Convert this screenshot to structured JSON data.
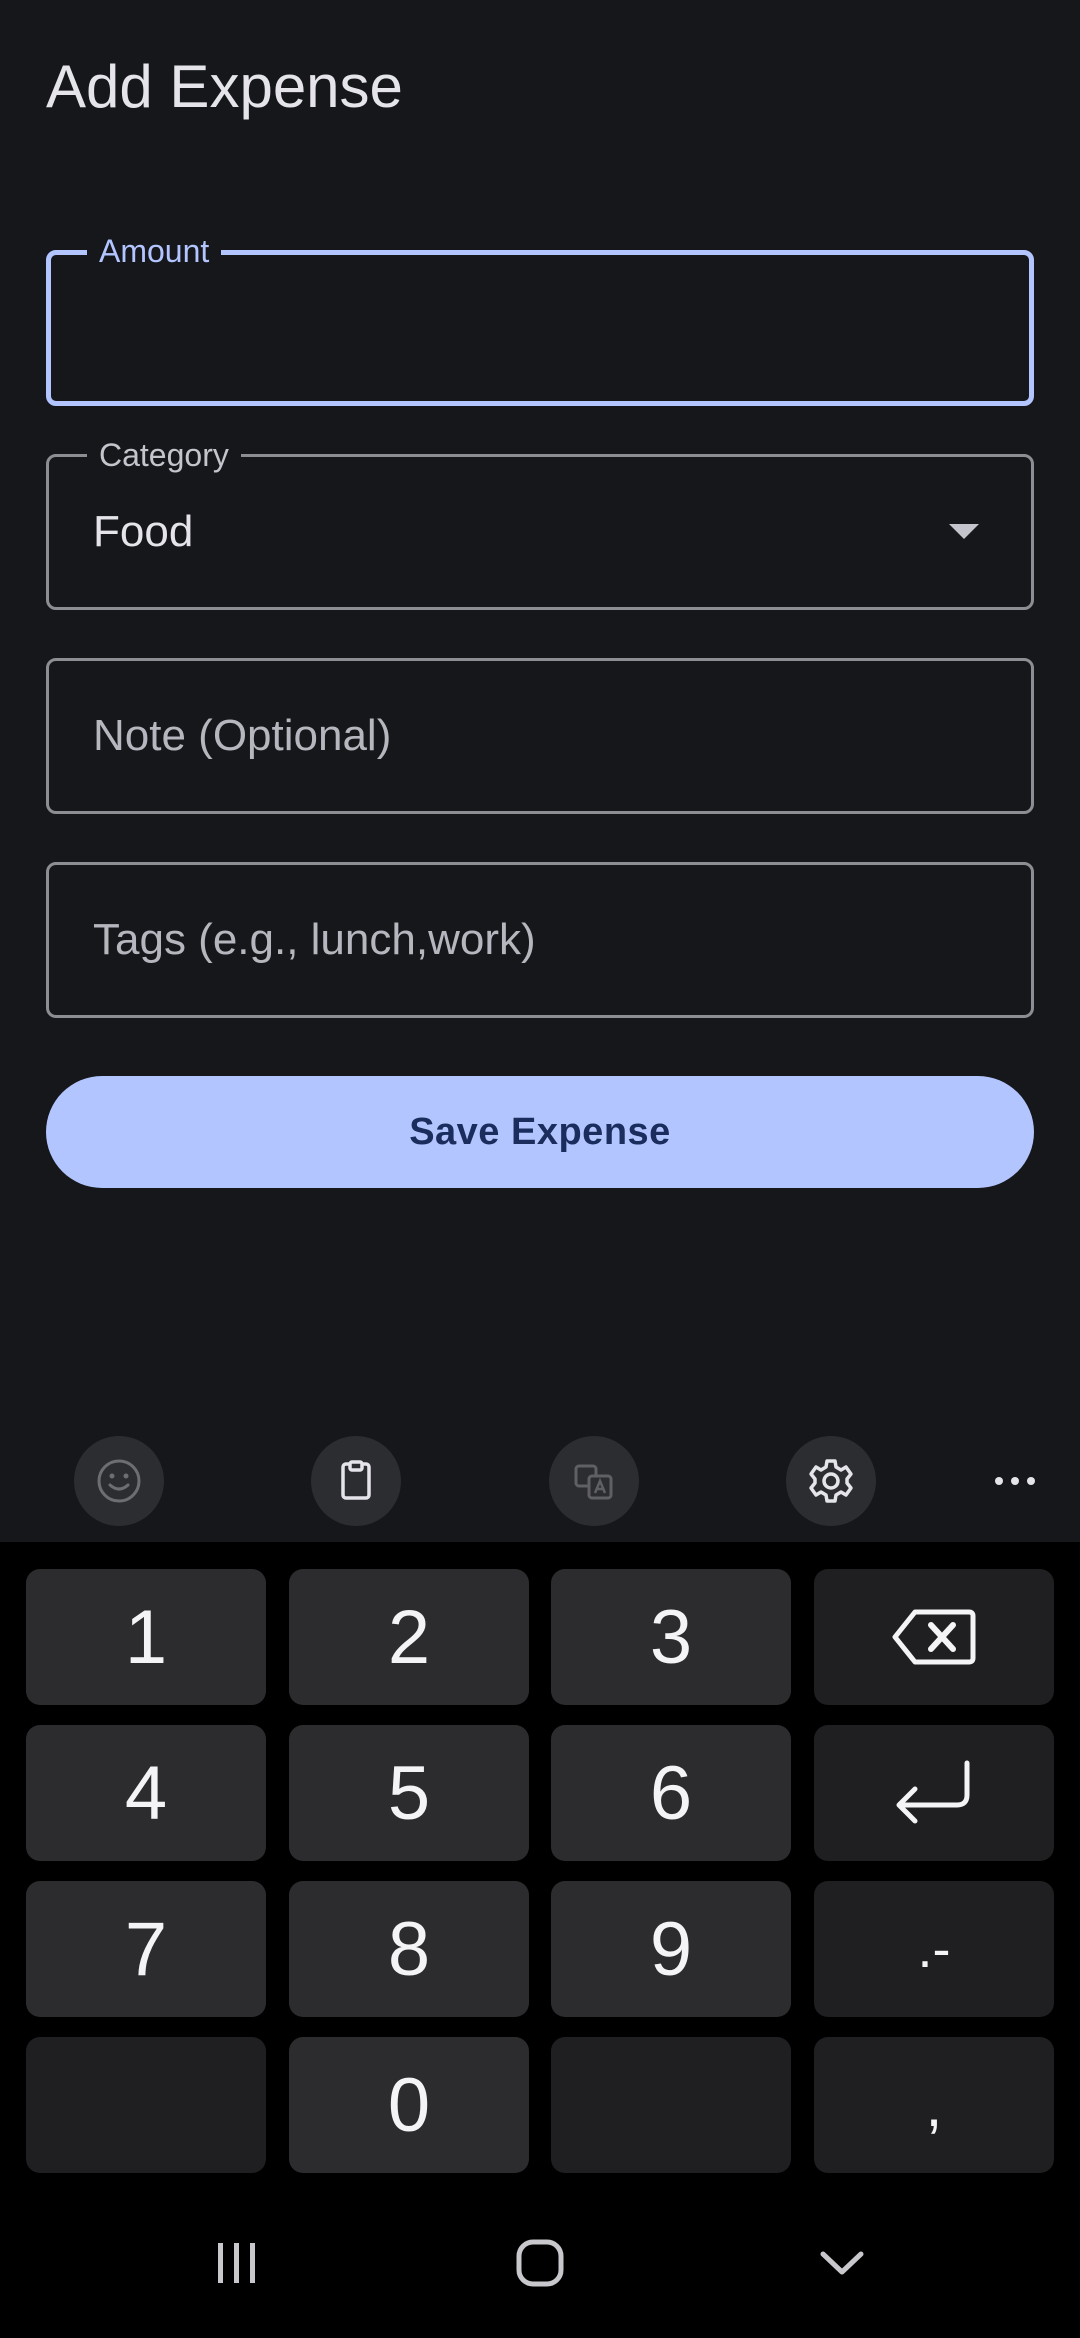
{
  "header": {
    "title": "Add Expense"
  },
  "form": {
    "amount": {
      "label": "Amount",
      "value": ""
    },
    "category": {
      "label": "Category",
      "value": "Food"
    },
    "note": {
      "placeholder": "Note (Optional)"
    },
    "tags": {
      "placeholder": "Tags (e.g., lunch,work)"
    },
    "save_label": "Save Expense"
  },
  "keyboard": {
    "toolbar": [
      "emoji-icon",
      "clipboard-icon",
      "translate-icon",
      "settings-icon",
      "more-icon"
    ],
    "keys": {
      "k1": "1",
      "k2": "2",
      "k3": "3",
      "k4": "4",
      "k5": "5",
      "k6": "6",
      "k7": "7",
      "k8": "8",
      "k9": "9",
      "k0": "0",
      "dot_dash": ".-",
      "comma": ","
    }
  },
  "colors": {
    "background": "#16171b",
    "accent": "#b2c5ff",
    "button_text": "#1a2d5c",
    "keyboard_bg": "#000000",
    "key_bg": "#2c2c2e"
  }
}
